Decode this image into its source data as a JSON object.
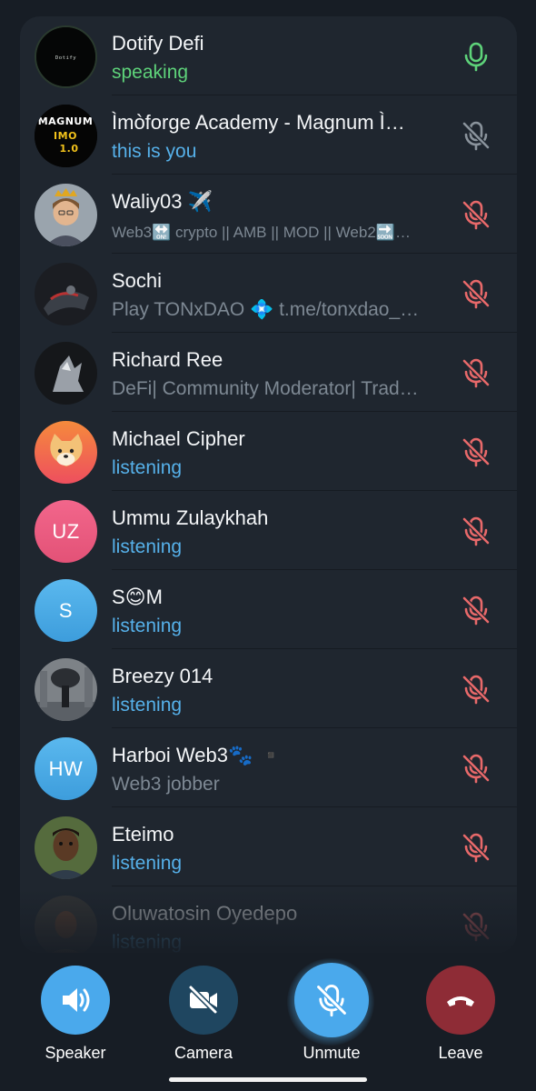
{
  "colors": {
    "background": "#171d25",
    "panel": "#1f262f",
    "speaking": "#5ed37a",
    "listening": "#56b1ea",
    "bio": "#7d8893",
    "mic_active": "#5ed37a",
    "mic_self": "#8a939c",
    "mic_muted": "#e8696a",
    "speaker_button": "#4aa9ec",
    "camera_button": "#1f4660",
    "unmute_button": "#4aa9ec",
    "leave_button": "#8e2c36"
  },
  "participants": [
    {
      "name": "Dotify Defi",
      "status": "speaking",
      "status_kind": "speaking",
      "mic": "mic-active-icon",
      "avatar_text": "Dotify"
    },
    {
      "name": "Ìmòforge Academy - Magnum Ì…",
      "status": "this is you",
      "status_kind": "you",
      "mic": "mic-off-icon",
      "avatar_text": "MAGNUM IMO 1.0"
    },
    {
      "name": "Waliy03 ✈️",
      "status": "Web3🔛 crypto || AMB || MOD || Web2🔜…",
      "status_kind": "bio",
      "mic": "mic-off-icon"
    },
    {
      "name": "Sochi",
      "status": "Play TONxDAO 💠 t.me/tonxdao_…",
      "status_kind": "bio",
      "mic": "mic-off-icon"
    },
    {
      "name": "Richard Ree",
      "status": "DeFi| Community Moderator| Trad…",
      "status_kind": "bio",
      "mic": "mic-off-icon"
    },
    {
      "name": "Michael Cipher",
      "status": "listening",
      "status_kind": "listening",
      "mic": "mic-off-icon"
    },
    {
      "name": "Ummu Zulaykhah",
      "status": "listening",
      "status_kind": "listening",
      "mic": "mic-off-icon",
      "initials": "UZ"
    },
    {
      "name": "S😊M",
      "status": "listening",
      "status_kind": "listening",
      "mic": "mic-off-icon",
      "initials": "S"
    },
    {
      "name": "Breezy 014",
      "status": "listening",
      "status_kind": "listening",
      "mic": "mic-off-icon"
    },
    {
      "name": "Harboi Web3🐾 ▪️",
      "status": "Web3 jobber",
      "status_kind": "bio",
      "mic": "mic-off-icon",
      "initials": "HW"
    },
    {
      "name": "Eteimo",
      "status": "listening",
      "status_kind": "listening",
      "mic": "mic-off-icon"
    },
    {
      "name": "Oluwatosin Oyedepo",
      "status": "listening",
      "status_kind": "listening",
      "mic": "mic-off-icon"
    }
  ],
  "controls": {
    "speaker": {
      "label": "Speaker",
      "icon": "speaker-icon"
    },
    "camera": {
      "label": "Camera",
      "icon": "camera-off-icon"
    },
    "unmute": {
      "label": "Unmute",
      "icon": "mic-off-icon"
    },
    "leave": {
      "label": "Leave",
      "icon": "hang-up-icon"
    }
  }
}
